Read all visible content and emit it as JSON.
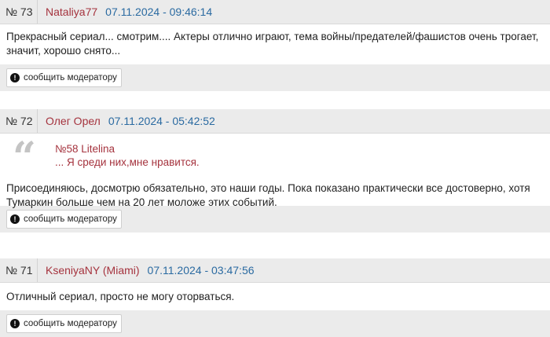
{
  "comments": [
    {
      "number": "№ 73",
      "author": "Nataliya77",
      "date": "07.11.2024 - 09:46:14",
      "text": "Прекрасный сериал... смотрим.... Актеры отлично играют, тема войны/предателей/фашистов очень трогает, значит, хорошо снято...",
      "report_label": "сообщить модератору"
    },
    {
      "number": "№ 72",
      "author": "Олег Орел",
      "date": "07.11.2024 - 05:42:52",
      "quote": {
        "ref": "№58 Litelina",
        "text": "... Я среди них,мне нравится."
      },
      "text": "Присоединяюсь, досмотрю обязательно, это наши годы. Пока показано практически все достоверно, хотя Тумаркин больше чем на 20 лет моложе этих событий.",
      "report_label": "сообщить модератору"
    },
    {
      "number": "№ 71",
      "author": "KseniyaNY (Miami)",
      "date": "07.11.2024 - 03:47:56",
      "text": "Отличный сериал, просто не могу оторваться.",
      "report_label": "сообщить модератору"
    }
  ],
  "icons": {
    "quote": "quote-icon",
    "report": "exclamation-circle-icon"
  },
  "colors": {
    "author": "#a5333e",
    "date": "#2a6aa1",
    "header_bg": "#ebebeb"
  }
}
